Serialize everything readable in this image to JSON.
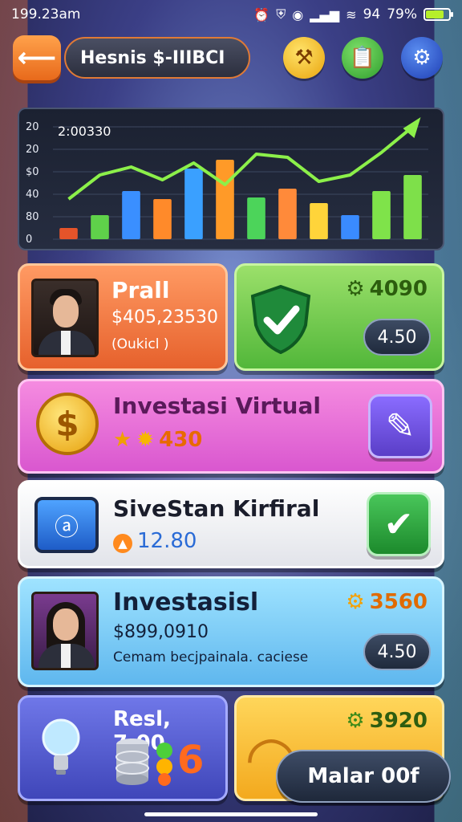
{
  "status_bar": {
    "time": "199.23am",
    "signal_text": "94",
    "battery_percent": "79%",
    "battery_level": 0.79,
    "battery_color": "#b6ef2a"
  },
  "header": {
    "back_icon": "arrow-left-icon",
    "title": "Hesnis $-IIIBCI",
    "buttons": [
      "hammer-icon",
      "clipboard-icon",
      "gear-icon"
    ]
  },
  "chart_data": {
    "type": "bar",
    "timestamp_label": "2:00330",
    "y_tick_labels": [
      "20",
      "20",
      "$0",
      "40",
      "80",
      "0"
    ],
    "values": [
      14,
      30,
      60,
      50,
      88,
      99,
      52,
      63,
      45,
      30,
      60,
      80
    ],
    "trend_line": [
      50,
      80,
      90,
      74,
      95,
      68,
      106,
      102,
      72,
      80,
      108,
      140
    ],
    "bar_colors": [
      "#e5542a",
      "#5fd14a",
      "#3a8fff",
      "#ff8a2a",
      "#3aa0ff",
      "#ff9a28",
      "#4cd45a",
      "#ff8a3a",
      "#ffd43a",
      "#3a8bff",
      "#7fe34a",
      "#7ee04a"
    ],
    "ylim": [
      0,
      140
    ]
  },
  "card_profile": {
    "name": "Prall",
    "amount": "$405,23530",
    "note": "(Oukicl )"
  },
  "card_status": {
    "score": "4090",
    "value": "4.50"
  },
  "card_virtual": {
    "title": "Investasi Virtual",
    "score": "430"
  },
  "card_kirfiral": {
    "title": "SiveStan Kirfiral",
    "value": "12.80"
  },
  "card_investasisl": {
    "title": "Investasisl",
    "amount": "$899,0910",
    "note": "Cemam becjpainala. caciese",
    "score": "3560",
    "value": "4.50"
  },
  "card_resl": {
    "title": "Resl, 7:00",
    "digit": "6"
  },
  "card_yellow": {
    "score": "3920"
  },
  "float_button": {
    "label": "Malar 00f"
  }
}
